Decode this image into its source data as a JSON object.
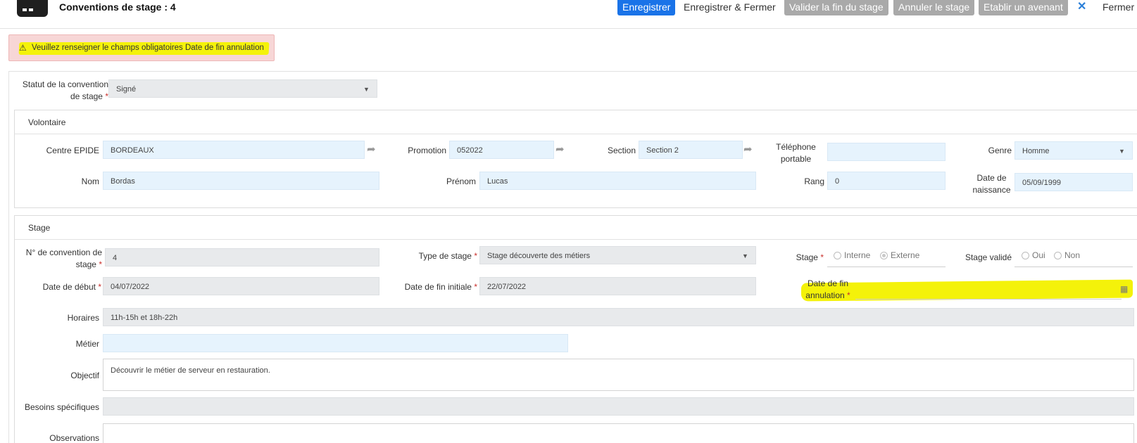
{
  "header": {
    "title": "Conventions de stage : 4",
    "buttons": {
      "save": "Enregistrer",
      "save_close": "Enregistrer & Fermer",
      "validate_end": "Valider la fin du stage",
      "cancel_stage": "Annuler le stage",
      "amendment": "Etablir un avenant",
      "close": "Fermer"
    }
  },
  "alert": {
    "icon": "warning-icon",
    "text": "Veuillez renseigner le champs obligatoires Date de fin annulation"
  },
  "statut": {
    "label_line1": "Statut de la convention",
    "label_line2": "de stage",
    "required": "*",
    "value": "Signé"
  },
  "volontaire": {
    "title": "Volontaire",
    "centre_label": "Centre EPIDE",
    "centre_value": "BORDEAUX",
    "promotion_label": "Promotion",
    "promotion_value": "052022",
    "section_label": "Section",
    "section_value": "Section 2",
    "telephone_label_line1": "Téléphone",
    "telephone_label_line2": "portable",
    "telephone_value": "",
    "genre_label": "Genre",
    "genre_value": "Homme",
    "nom_label": "Nom",
    "nom_value": "Bordas",
    "prenom_label": "Prénom",
    "prenom_value": "Lucas",
    "rang_label": "Rang",
    "rang_value": "0",
    "naissance_label_line1": "Date de",
    "naissance_label_line2": "naissance",
    "naissance_value": "05/09/1999"
  },
  "stage": {
    "title": "Stage",
    "numero_label_line1": "N° de convention de",
    "numero_label_line2": "stage",
    "numero_value": "4",
    "type_label": "Type de stage",
    "type_value": "Stage découverte des métiers",
    "stage_label": "Stage",
    "radio_interne": "Interne",
    "radio_externe": "Externe",
    "valide_label": "Stage validé",
    "radio_oui": "Oui",
    "radio_non": "Non",
    "debut_label": "Date de début",
    "debut_value": "04/07/2022",
    "fin_initiale_label": "Date de fin initiale",
    "fin_initiale_value": "22/07/2022",
    "fin_annulation_label_line1": "Date de fin",
    "fin_annulation_label_line2": "annulation",
    "fin_annulation_value": "",
    "horaires_label": "Horaires",
    "horaires_value": "11h-15h et 18h-22h",
    "metier_label": "Métier",
    "metier_value": "",
    "objectif_label": "Objectif",
    "objectif_value": "Découvrir le métier de serveur en restauration.",
    "besoins_label": "Besoins spécifiques",
    "besoins_value": "",
    "observations_label": "Observations",
    "observations_value": "",
    "required": "*"
  },
  "colors": {
    "primary": "#1a73e8",
    "disabled_button": "#a9a9a9",
    "alert_bg": "#f7d6d6",
    "highlight": "#f4f20a",
    "input_blue": "#e6f3fd",
    "input_grey": "#e8eaec"
  }
}
